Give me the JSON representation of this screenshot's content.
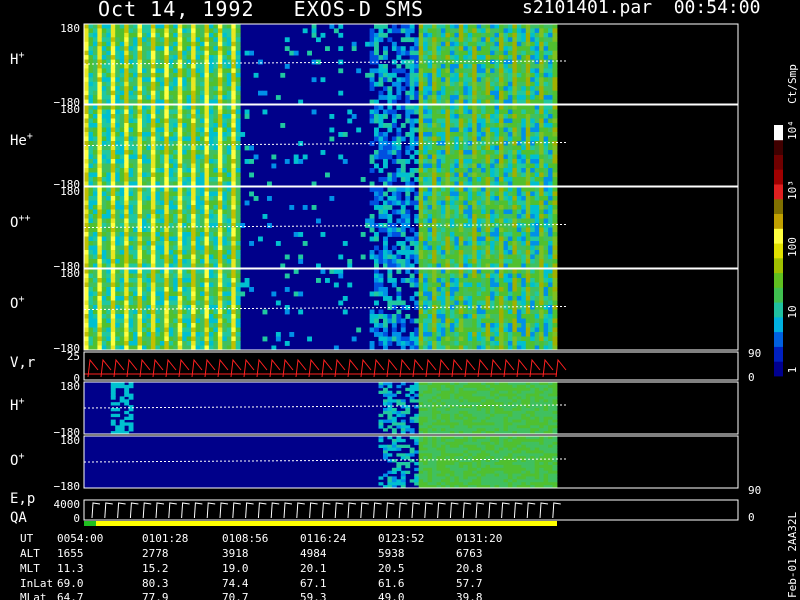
{
  "header": {
    "title": "Oct 14, 1992   EXOS-D SMS",
    "file": "s2101401.par  00:54:00"
  },
  "colorbar": {
    "label": "Ct/Smp",
    "ticks": [
      "10⁴",
      "10³",
      "100",
      "10",
      "1"
    ]
  },
  "footer": {
    "right_text": "Feb-01 2AA32L"
  },
  "colors": {
    "background": "#000000",
    "trace": "#ff2020",
    "qa_green": "#20c020",
    "qa_yellow": "#ffff00"
  },
  "chart_data": {
    "type": "heatmap",
    "panels": [
      {
        "name": "H⁺",
        "ylim": [
          -180,
          180
        ],
        "ticks": [
          "180",
          "−180"
        ]
      },
      {
        "name": "He⁺",
        "ylim": [
          -180,
          180
        ],
        "ticks": [
          "180",
          "−180"
        ]
      },
      {
        "name": "O⁺⁺",
        "ylim": [
          -180,
          180
        ],
        "ticks": [
          "180",
          "−180"
        ]
      },
      {
        "name": "O⁺",
        "ylim": [
          -180,
          180
        ],
        "ticks": [
          "180",
          "−180"
        ]
      },
      {
        "name": "V,r",
        "ylim": [
          0,
          25
        ],
        "ticks": [
          "25",
          "0"
        ],
        "right_ticks": [
          "90",
          "0"
        ]
      },
      {
        "name": "H⁺",
        "ylim": [
          -180,
          180
        ],
        "ticks": [
          "180",
          "−180"
        ]
      },
      {
        "name": "O⁺",
        "ylim": [
          -180,
          180
        ],
        "ticks": [
          "180",
          "−180"
        ],
        "right_ticks": [
          "90"
        ]
      },
      {
        "name": "E,p",
        "ylim": [
          0,
          4000
        ],
        "ticks": [
          "4000",
          "0"
        ],
        "right_ticks": [
          "0"
        ]
      },
      {
        "name": "QA"
      }
    ],
    "row_labels": [
      "UT",
      "ALT",
      "MLT",
      "InLat",
      "MLat"
    ],
    "columns": [
      [
        "0054:00",
        "1655",
        "11.3",
        "69.0",
        "64.7"
      ],
      [
        "0101:28",
        "2778",
        "15.2",
        "80.3",
        "77.9"
      ],
      [
        "0108:56",
        "3918",
        "19.0",
        "74.4",
        "70.7"
      ],
      [
        "0116:24",
        "4984",
        "20.1",
        "67.1",
        "59.3"
      ],
      [
        "0123:52",
        "5938",
        "20.5",
        "61.6",
        "49.0"
      ],
      [
        "0131:20",
        "6763",
        "20.8",
        "57.7",
        "39.8"
      ]
    ]
  }
}
